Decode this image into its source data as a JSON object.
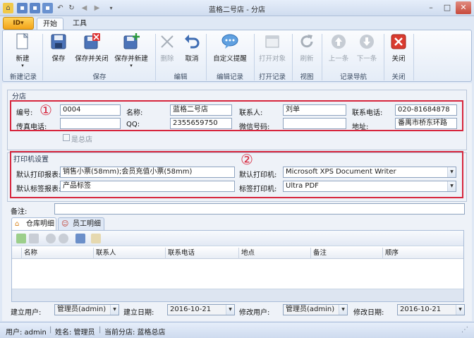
{
  "window": {
    "title": "蓝格二号店 - 分店"
  },
  "ribbon": {
    "file_label": "ID▾",
    "tabs": [
      "开始",
      "工具"
    ],
    "buttons": {
      "new": "新建",
      "save": "保存",
      "save_close": "保存并关闭",
      "save_new": "保存并新建",
      "delete": "删除",
      "cancel": "取消",
      "custom_alert": "自定义提醒",
      "open_object": "打开对象",
      "refresh": "刷新",
      "prev": "上一条",
      "next": "下一条",
      "close": "关闭"
    },
    "groups": {
      "new_record": "新建记录",
      "save": "保存",
      "edit": "编辑",
      "edit_record": "编辑记录",
      "open_record": "打开记录",
      "view": "视图",
      "record_nav": "记录导航",
      "close": "关闭"
    }
  },
  "branch": {
    "legend": "分店",
    "marker": "①",
    "code_label": "编号:",
    "code_value": "0004",
    "name_label": "名称:",
    "name_value": "蓝格二号店",
    "contact_label": "联系人:",
    "contact_value": "刘单",
    "phone_label": "联系电话:",
    "phone_value": "020-81684878",
    "fax_label": "传真电话:",
    "fax_value": "",
    "qq_label": "QQ:",
    "qq_value": "2355659750",
    "wechat_label": "微信号码:",
    "wechat_value": "",
    "address_label": "地址:",
    "address_value": "番禺市桥东环路",
    "is_head_label": "是总店"
  },
  "printer": {
    "legend": "打印机设置",
    "marker": "②",
    "default_report_label": "默认打印报表:",
    "default_report_value": "销售小票(58mm);会员充值小票(58mm)",
    "default_label_report_label": "默认标签报表:",
    "default_label_report_value": "产品标签",
    "default_printer_label": "默认打印机:",
    "default_printer_value": "Microsoft XPS Document Writer",
    "label_printer_label": "标签打印机:",
    "label_printer_value": "Ultra PDF"
  },
  "notes": {
    "label": "备注:",
    "value": ""
  },
  "grid": {
    "tabs": [
      "仓库明细",
      "员工明细"
    ],
    "columns": [
      "名称",
      "联系人",
      "联系电话",
      "地点",
      "备注",
      "顺序"
    ]
  },
  "audit": {
    "created_by_label": "建立用户:",
    "created_by_value": "管理员(admin)",
    "created_date_label": "建立日期:",
    "created_date_value": "2016-10-21",
    "modified_by_label": "修改用户:",
    "modified_by_value": "管理员(admin)",
    "modified_date_label": "修改日期:",
    "modified_date_value": "2016-10-21"
  },
  "status": {
    "user": "用户: admin",
    "name": "姓名: 管理员",
    "branch": "当前分店: 蓝格总店"
  },
  "colors": {
    "highlight_border": "#d7263d",
    "accent": "#2f6fc6"
  }
}
